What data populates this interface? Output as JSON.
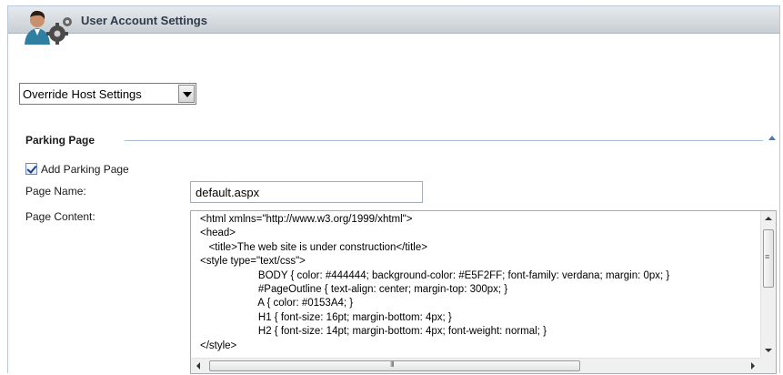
{
  "window": {
    "title": "User Account Settings"
  },
  "icons": {
    "user_icon": "user-settings-icon"
  },
  "host_settings": {
    "selected": "Override Host Settings"
  },
  "parking": {
    "section_title": "Parking Page",
    "add_checkbox_label": "Add Parking Page",
    "add_checked": true,
    "page_name_label": "Page Name:",
    "page_name_value": "default.aspx",
    "page_content_label": "Page Content:",
    "page_content_lines": [
      "<html xmlns=\"http://www.w3.org/1999/xhtml\">",
      "<head>",
      "   <title>The web site is under construction</title>",
      "<style type=\"text/css\">",
      "                    BODY { color: #444444; background-color: #E5F2FF; font-family: verdana; margin: 0px; }",
      "                    #PageOutline { text-align: center; margin-top: 300px; }",
      "                    A { color: #0153A4; }",
      "                    H1 { font-size: 16pt; margin-bottom: 4px; }",
      "                    H2 { font-size: 14pt; margin-bottom: 4px; font-weight: normal; }",
      "</style>"
    ]
  },
  "colors": {
    "section_line": "#a9bfd9",
    "accent": "#4a78b5"
  }
}
